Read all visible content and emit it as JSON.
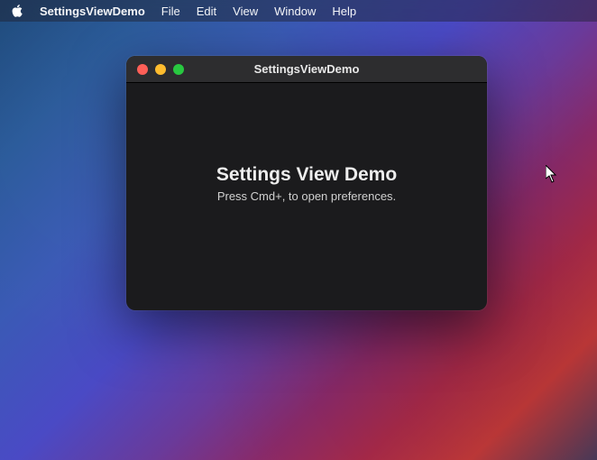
{
  "menubar": {
    "app_name": "SettingsViewDemo",
    "items": [
      "File",
      "Edit",
      "View",
      "Window",
      "Help"
    ]
  },
  "window": {
    "title": "SettingsViewDemo",
    "content": {
      "heading": "Settings View Demo",
      "subheading": "Press Cmd+, to open preferences."
    }
  }
}
